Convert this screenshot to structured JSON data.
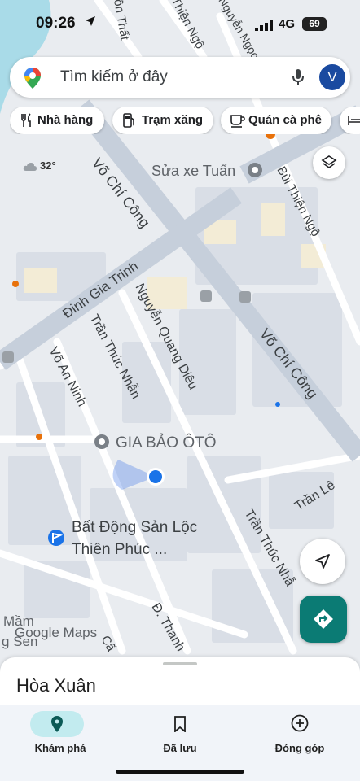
{
  "status_bar": {
    "time": "09:26",
    "network": "4G",
    "battery": "69"
  },
  "search": {
    "placeholder": "Tìm kiếm ở đây",
    "avatar_letter": "V"
  },
  "chips": [
    {
      "label": "Nhà hàng",
      "icon": "fork-knife-icon"
    },
    {
      "label": "Trạm xăng",
      "icon": "gas-pump-icon"
    },
    {
      "label": "Quán cà phê",
      "icon": "coffee-cup-icon"
    }
  ],
  "weather": {
    "temperature": "32°"
  },
  "map": {
    "streets": [
      "Võ Chí Công",
      "Đinh Gia Trinh",
      "Nguyễn Quang Diêu",
      "Trần Thúc Nhẫn",
      "Võ An Ninh",
      "Bùi Thiện Ngộ",
      "Võ Chí Công",
      "Trần Lê",
      "Trần Thúc Nhẫ",
      "Đ. Thanh",
      "Thiện Ngộ",
      "ồn Thất",
      "Nguyễn Ngọc Đ",
      "Cẩ"
    ],
    "pois": [
      {
        "name": "Sửa xe Tuấn"
      },
      {
        "name": "GIA BẢO ÔTÔ"
      },
      {
        "name_line1": "Bất Động Sản Lộc",
        "name_line2": "Thiên Phúc ..."
      }
    ],
    "area_labels": [
      "Mầm",
      "g Sen"
    ],
    "logo": {
      "google": "Google",
      "maps": "Maps"
    }
  },
  "sheet": {
    "place_name": "Hòa Xuân"
  },
  "bottom_nav": [
    {
      "label": "Khám phá",
      "icon": "location-pin-icon",
      "active": true
    },
    {
      "label": "Đã lưu",
      "icon": "bookmark-icon",
      "active": false
    },
    {
      "label": "Đóng góp",
      "icon": "add-circle-icon",
      "active": false
    }
  ],
  "colors": {
    "map_bg": "#e8ebef",
    "road": "#c9d1dc",
    "water": "#9fd8e6",
    "building": "#d8dde5",
    "accent_blue": "#1a73e8",
    "teal": "#0b7b74"
  }
}
